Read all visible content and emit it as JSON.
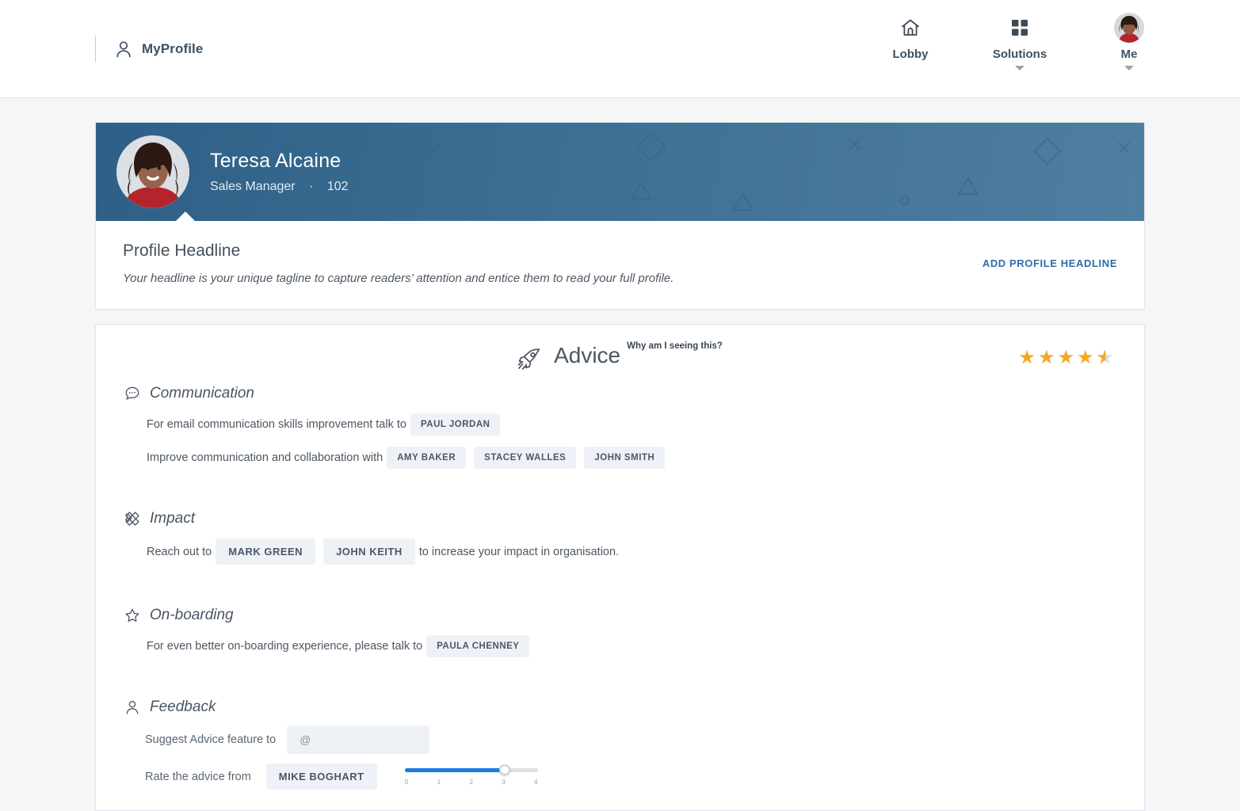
{
  "topbar": {
    "brand_label": "MyProfile",
    "brand_icon": "person-icon",
    "nav": [
      {
        "label": "Lobby",
        "icon": "home-icon",
        "has_caret": false
      },
      {
        "label": "Solutions",
        "icon": "grid-icon",
        "has_caret": true
      },
      {
        "label": "Me",
        "icon": "avatar-icon",
        "has_caret": true
      }
    ]
  },
  "profile": {
    "name": "Teresa Alcaine",
    "role": "Sales Manager",
    "separator": "·",
    "id": "102",
    "banner_color": "#3d6f94"
  },
  "headline": {
    "title": "Profile Headline",
    "description": "Your headline is your unique tagline to capture readers’ attention and entice them to read your full profile.",
    "action_label": "ADD PROFILE HEADLINE",
    "action_color": "#2f6ca8"
  },
  "advice": {
    "title": "Advice",
    "icon": "rocket-icon",
    "why_link": "Why am I seeing this?",
    "rating": 4.5,
    "rating_max": 5,
    "star_color": "#f5a623",
    "sections": [
      {
        "key": "communication",
        "title": "Communication",
        "icon": "speech-bubble-icon",
        "lines": [
          {
            "prefix": "For email communication skills improvement talk to",
            "chips": [
              "PAUL JORDAN"
            ],
            "suffix": ""
          },
          {
            "prefix": "Improve communication and collaboration with",
            "chips": [
              "AMY BAKER",
              "STACEY WALLES",
              "JOHN SMITH"
            ],
            "suffix": ""
          }
        ]
      },
      {
        "key": "impact",
        "title": "Impact",
        "icon": "crossed-diamonds-icon",
        "lines": [
          {
            "prefix": "Reach out to",
            "chips": [
              "MARK GREEN",
              "JOHN KEITH"
            ],
            "suffix": "to increase your impact in organisation."
          }
        ]
      },
      {
        "key": "onboarding",
        "title": "On-boarding",
        "icon": "star-outline-icon",
        "lines": [
          {
            "prefix": "For even better on-boarding experience, please talk to",
            "chips": [
              "PAULA CHENNEY"
            ],
            "suffix": ""
          }
        ]
      }
    ],
    "feedback": {
      "title": "Feedback",
      "icon": "person-icon",
      "suggest_label": "Suggest Advice feature to",
      "suggest_placeholder": "@",
      "suggest_value": "",
      "rate_label": "Rate the advice from",
      "rate_person": "MIKE BOGHART",
      "slider": {
        "value": 3,
        "min": 0,
        "max": 4,
        "ticks": [
          "0",
          "1",
          "2",
          "3",
          "4"
        ],
        "fill_color": "#1d7ae0"
      }
    }
  }
}
